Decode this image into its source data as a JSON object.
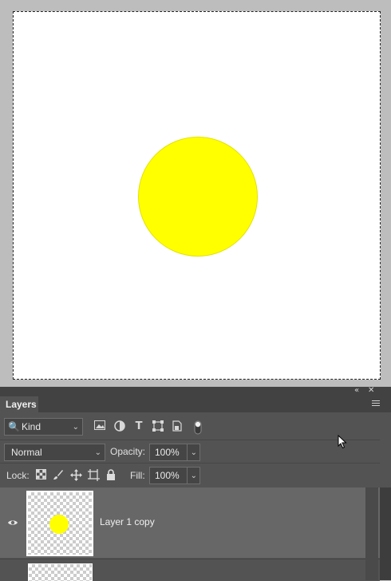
{
  "panel": {
    "collapse_glyph": "«",
    "close_glyph": "✕",
    "tab_label": "Layers",
    "menu_icon": "panel-menu-icon"
  },
  "filter": {
    "kind_label": "Kind",
    "icons": [
      "image-filter-icon",
      "adjustment-filter-icon",
      "type-filter-icon",
      "shape-filter-icon",
      "smart-object-filter-icon",
      "filter-toggle-icon"
    ]
  },
  "blend": {
    "mode": "Normal",
    "opacity_label": "Opacity:",
    "opacity_value": "100%"
  },
  "lock": {
    "label": "Lock:",
    "icons": [
      "lock-transparent-pixels-icon",
      "lock-image-pixels-icon",
      "lock-position-icon",
      "lock-artboard-icon",
      "lock-all-icon"
    ],
    "fill_label": "Fill:",
    "fill_value": "100%"
  },
  "layers": [
    {
      "name": "Layer 1 copy",
      "visible": true,
      "selected": true
    },
    {
      "name": "",
      "visible": false,
      "selected": false
    }
  ],
  "colors": {
    "circle_fill": "#ffff00",
    "circle_stroke": "#e2e200",
    "panel_bg": "#535353",
    "selected_row": "#676767"
  }
}
